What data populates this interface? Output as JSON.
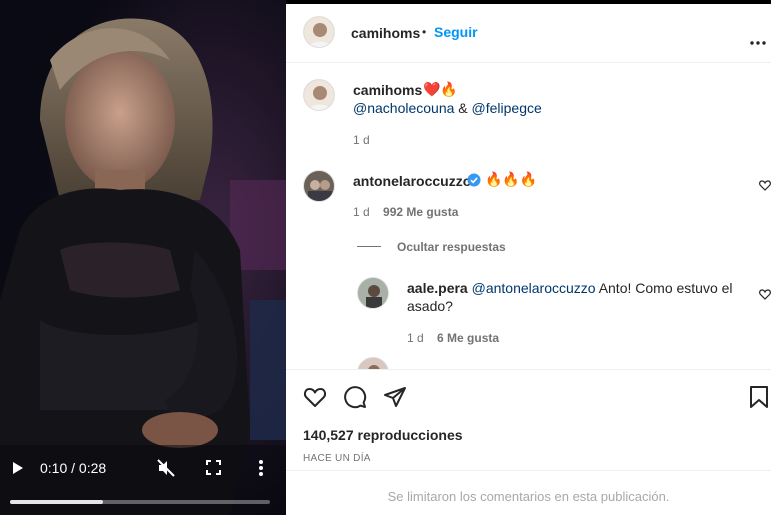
{
  "video": {
    "time": "0:10 / 0:28",
    "progress": 0.357,
    "icons": [
      "play-icon",
      "mute-icon",
      "fullscreen-icon",
      "more-vertical-icon"
    ]
  },
  "header": {
    "username": "camihoms",
    "dot": "•",
    "follow_label": "Seguir",
    "more_icon": "more-horizontal-icon"
  },
  "caption": {
    "username": "camihoms",
    "emoji": "❤️🔥",
    "mention1": "@nacholecouna",
    "amp": "&",
    "mention2": "@felipegce",
    "time": "1 d"
  },
  "comments": [
    {
      "username": "antonelaroccuzzo",
      "verified": true,
      "text": "🔥🔥🔥",
      "time": "1 d",
      "likes": "992 Me gusta"
    }
  ],
  "hide_replies": "Ocultar respuestas",
  "replies": [
    {
      "username": "aale.pera",
      "mention": "@antonelaroccuzzo",
      "text": "Anto! Como estuvo el asado?",
      "time": "1 d",
      "likes": "6 Me gusta"
    }
  ],
  "actions": {
    "icons": [
      "heart-icon",
      "comment-icon",
      "share-icon",
      "bookmark-icon"
    ],
    "views": "140,527 reproducciones",
    "posted": "HACE UN DÍA"
  },
  "footer": {
    "note": "Se limitaron los comentarios en esta publicación."
  },
  "colors": {
    "link": "#0095f6",
    "mention": "#00376b",
    "verified": "#3897f0",
    "muted": "#737373"
  }
}
